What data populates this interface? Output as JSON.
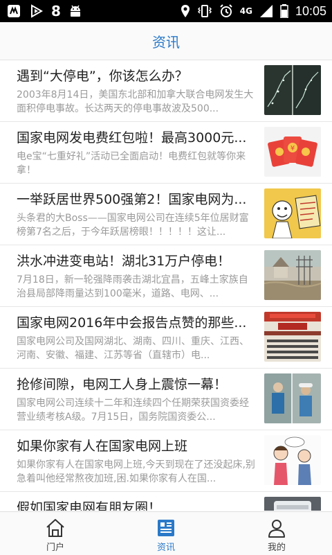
{
  "status_bar": {
    "left_icons": [
      "notification-m-icon",
      "play-icon",
      "eight-icon",
      "android-icon"
    ],
    "app_badge": "8",
    "network": "4G",
    "time": "10:05"
  },
  "header": {
    "title": "资讯"
  },
  "news": [
    {
      "title": "遇到“大停电”，你该怎么办？",
      "desc": "2003年8月14日，美国东北部和加拿大联合电网发生大面积停电事故。长达两天的停电事故波及500...",
      "thumb": "satellite-night-image"
    },
    {
      "title": "国家电网发电费红包啦！最高3000元...",
      "desc": "电e宝“七重好礼”活动已全面启动！电费红包就等你来拿！",
      "thumb": "red-envelopes-image",
      "thumb_mark": "¥"
    },
    {
      "title": "一举跃居世界500强第2！国家电网为...",
      "desc": "头条君的大Boss——国家电网公司在连续5年位居财富榜第7名之后，于今年跃居榜眼！！！！！这让...",
      "thumb": "cartoon-meme-image"
    },
    {
      "title": "洪水冲进变电站！湖北31万户停电！",
      "desc": "7月18日，新一轮强降雨袭击湖北宜昌，五峰土家族自治县局部降雨量达到100毫米，道路、电网、...",
      "thumb": "flooded-substation-image"
    },
    {
      "title": "国家电网2016年中会报告点赞的那些...",
      "desc": "国家电网公司及国网湖北、湖南、四川、重庆、江西、河南、安徽、福建、江苏等省（直辖市）电...",
      "thumb": "conference-hall-image"
    },
    {
      "title": "抢修间隙，电网工人身上震惊一幕！",
      "desc": "国家电网公司连续十二年和连续四个任期荣获国资委经营业绩考核A级。7月15日，国务院国资委公...",
      "thumb": "workers-image"
    },
    {
      "title": "如果你家有人在国家电网上班",
      "desc": "如果你家有人在国家电网上班,今天到现在了还没起床,别急着叫他经常熬夜加班,困.如果你家有人在国...",
      "thumb": "cartoon-couple-image"
    },
    {
      "title": "假如国家电网有朋友圈！",
      "desc": "",
      "thumb": "phone-screenshot-image"
    }
  ],
  "tabbar": {
    "tabs": [
      {
        "label": "门户",
        "icon": "home-icon"
      },
      {
        "label": "资讯",
        "icon": "news-icon"
      },
      {
        "label": "我的",
        "icon": "person-icon"
      }
    ],
    "active_color": "#2a79c8"
  },
  "colors": {
    "accent": "#2a79c8"
  }
}
